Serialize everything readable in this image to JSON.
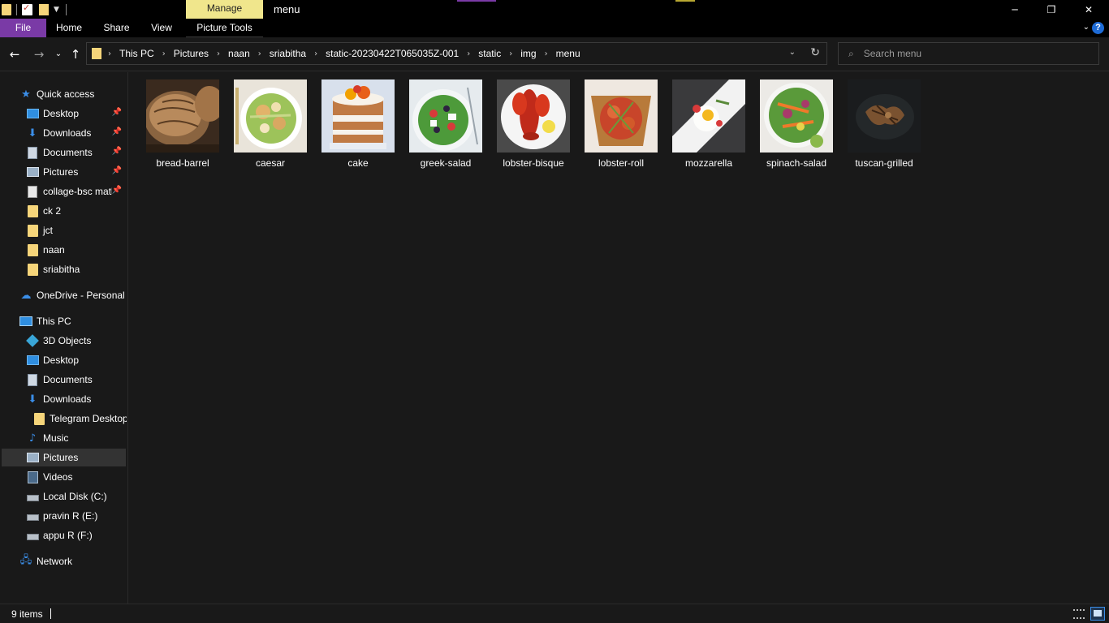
{
  "window": {
    "title": "menu",
    "manage_tab": "Manage",
    "minimize_glyph": "─",
    "restore_glyph": "❐",
    "close_glyph": "✕"
  },
  "ribbon": {
    "tabs": [
      "File",
      "Home",
      "Share",
      "View",
      "Picture Tools"
    ],
    "expand_glyph": "⌄",
    "help_glyph": "?"
  },
  "navigation": {
    "back_glyph": "←",
    "forward_glyph": "→",
    "recent_glyph": "⌄",
    "up_glyph": "↑",
    "breadcrumbs": [
      "This PC",
      "Pictures",
      "naan",
      "sriabitha",
      "static-20230422T065035Z-001",
      "static",
      "img",
      "menu"
    ],
    "separator_glyph": "›",
    "dropdown_glyph": "⌄",
    "refresh_glyph": "↻"
  },
  "search": {
    "placeholder": "Search menu",
    "icon": "search-icon"
  },
  "sidebar": {
    "pin_glyph": "📌",
    "quick_access": {
      "label": "Quick access",
      "items": [
        {
          "label": "Desktop",
          "icon": "desktop-icon",
          "pinned": true
        },
        {
          "label": "Downloads",
          "icon": "download-icon",
          "pinned": true
        },
        {
          "label": "Documents",
          "icon": "document-icon",
          "pinned": true
        },
        {
          "label": "Pictures",
          "icon": "pictures-icon",
          "pinned": true
        },
        {
          "label": "collage-bsc matl",
          "icon": "file-icon",
          "pinned": true
        },
        {
          "label": "ck 2",
          "icon": "folder-icon",
          "pinned": false
        },
        {
          "label": "jct",
          "icon": "folder-icon",
          "pinned": false
        },
        {
          "label": "naan",
          "icon": "folder-icon",
          "pinned": false
        },
        {
          "label": "sriabitha",
          "icon": "folder-icon",
          "pinned": false
        }
      ]
    },
    "onedrive": {
      "label": "OneDrive - Personal"
    },
    "this_pc": {
      "label": "This PC",
      "items": [
        {
          "label": "3D Objects",
          "icon": "cube-icon"
        },
        {
          "label": "Desktop",
          "icon": "desktop-icon"
        },
        {
          "label": "Documents",
          "icon": "document-icon"
        },
        {
          "label": "Downloads",
          "icon": "download-icon"
        },
        {
          "label": "Telegram Desktop",
          "icon": "folder-icon"
        },
        {
          "label": "Music",
          "icon": "music-icon"
        },
        {
          "label": "Pictures",
          "icon": "pictures-icon",
          "selected": true
        },
        {
          "label": "Videos",
          "icon": "video-icon"
        },
        {
          "label": "Local Disk (C:)",
          "icon": "drive-icon"
        },
        {
          "label": "pravin R  (E:)",
          "icon": "drive-icon"
        },
        {
          "label": "appu R  (F:)",
          "icon": "drive-icon"
        }
      ]
    },
    "network": {
      "label": "Network"
    }
  },
  "files": [
    {
      "name": "bread-barrel",
      "thumb": "bread"
    },
    {
      "name": "caesar",
      "thumb": "caesar"
    },
    {
      "name": "cake",
      "thumb": "cake"
    },
    {
      "name": "greek-salad",
      "thumb": "greek"
    },
    {
      "name": "lobster-bisque",
      "thumb": "lobster"
    },
    {
      "name": "lobster-roll",
      "thumb": "roll"
    },
    {
      "name": "mozzarella",
      "thumb": "mozzarella"
    },
    {
      "name": "spinach-salad",
      "thumb": "spinach"
    },
    {
      "name": "tuscan-grilled",
      "thumb": "tuscan"
    }
  ],
  "status": {
    "item_count": "9 items"
  },
  "colors": {
    "background": "#191919",
    "file_tab": "#7a3aa6",
    "manage_tab": "#f0e68c",
    "accent_blue": "#3b8ee8",
    "selected_row": "#333333"
  }
}
